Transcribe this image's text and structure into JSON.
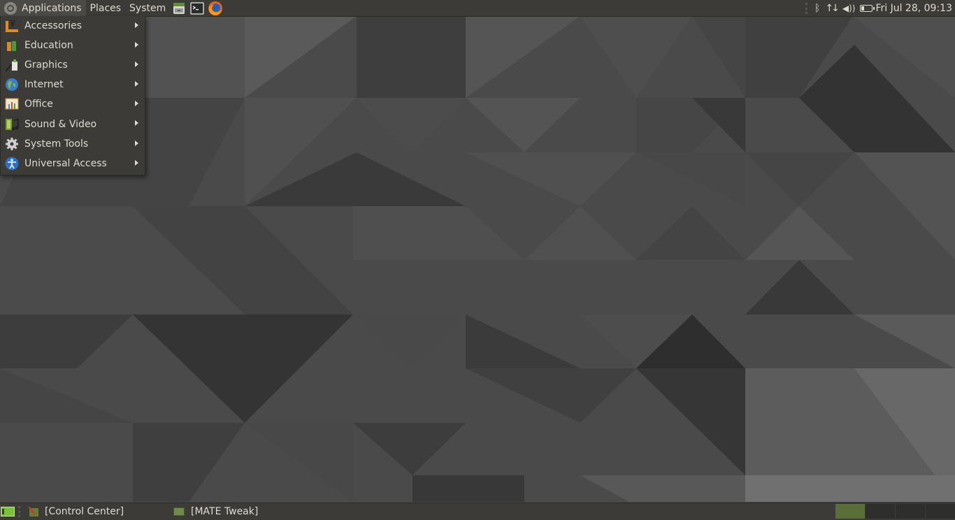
{
  "top_panel": {
    "menus": [
      {
        "label": "Applications",
        "active": true
      },
      {
        "label": "Places"
      },
      {
        "label": "System"
      }
    ],
    "launchers": [
      "file-manager-icon",
      "terminal-icon",
      "firefox-icon"
    ],
    "tray": {
      "icons": [
        "bluetooth-icon",
        "network-icon",
        "volume-icon",
        "battery-icon"
      ],
      "clock": "Fri Jul 28, 09:13"
    }
  },
  "applications_menu": {
    "items": [
      {
        "label": "Accessories",
        "icon": "accessories-icon"
      },
      {
        "label": "Education",
        "icon": "education-icon"
      },
      {
        "label": "Graphics",
        "icon": "graphics-icon"
      },
      {
        "label": "Internet",
        "icon": "internet-icon"
      },
      {
        "label": "Office",
        "icon": "office-icon"
      },
      {
        "label": "Sound & Video",
        "icon": "sound-video-icon"
      },
      {
        "label": "System Tools",
        "icon": "system-tools-icon"
      },
      {
        "label": "Universal Access",
        "icon": "universal-access-icon"
      }
    ]
  },
  "bottom_panel": {
    "tasks": [
      {
        "label": "[Control Center]"
      },
      {
        "label": "[MATE Tweak]"
      }
    ],
    "workspaces": {
      "count": 4,
      "active": 1
    },
    "colors": {
      "active_workspace": "#5a6e3a",
      "inactive_workspace": "#2e2e2d"
    }
  }
}
